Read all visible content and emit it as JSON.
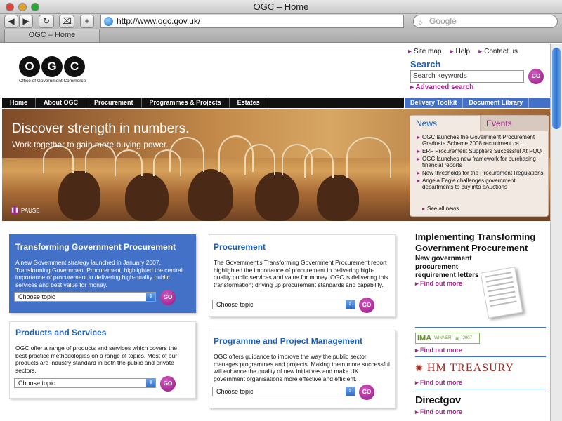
{
  "browser": {
    "window_title": "OGC – Home",
    "url": "http://www.ogc.gov.uk/",
    "search_placeholder": "Google",
    "tab_title": "OGC – Home"
  },
  "header": {
    "logo_letters": [
      "O",
      "G",
      "C"
    ],
    "logo_subtitle": "Office of Government Commerce",
    "top_links": [
      "Site map",
      "Help",
      "Contact us"
    ],
    "search_label": "Search",
    "search_placeholder": "Search keywords",
    "go_label": "GO",
    "advanced_search": "Advanced search"
  },
  "nav": {
    "left": [
      "Home",
      "About OGC",
      "Procurement",
      "Programmes & Projects",
      "Estates"
    ],
    "right": [
      "Delivery Toolkit",
      "Document Library"
    ]
  },
  "hero": {
    "headline": "Discover strength in numbers.",
    "subline": "Work together to gain more buying power.",
    "pause_label": "PAUSE"
  },
  "news": {
    "tabs": [
      "News",
      "Events"
    ],
    "items": [
      "OGC launches the Government Procurement Graduate Scheme 2008 recruitment ca...",
      "ERF Procurement Suppliers Successful At PQQ",
      "OGC launches new framework for purchasing financial reports",
      "New thresholds for the Procurement Regulations",
      "Angela Eagle challenges government departments to buy into eAuctions"
    ],
    "see_all": "See all news"
  },
  "cards": [
    {
      "title": "Transforming Government Procurement",
      "body": "A new Government strategy launched in January 2007, Transforming Government Procurement, highlighted the central importance of procurement in delivering high-quality public services and best value for money.",
      "select": "Choose topic"
    },
    {
      "title": "Procurement",
      "body": "The Government's Transforming Government Procurement report highlighted the importance of procurement in delivering high-quality public services and value for money. OGC is delivering this transformation; driving up procurement standards and capability.",
      "select": "Choose topic"
    },
    {
      "title": "Products and Services",
      "body": "OGC offer a range of products and services which covers the best practice methodologies on a range of topics. Most of our products are industry standard in both the public and private sectors.",
      "select": "Choose topic"
    },
    {
      "title": "Programme and Project Management",
      "body": "OGC offers guidance to improve the way the public sector manages programmes and projects. Making them more successful will enhance the quality of new initiatives and make UK government organisations more effective and efficient.",
      "select": "Choose topic"
    }
  ],
  "right": {
    "feature_title": "Implementing Transforming Government Procurement",
    "feature_sub": "New government procurement requirement letters",
    "find_out_more": "Find out more",
    "ima_label": "IMA",
    "ima_winner": "WINNER",
    "ima_year": "2007",
    "hm_treasury": "HM TREASURY",
    "directgov": "Directgov"
  }
}
